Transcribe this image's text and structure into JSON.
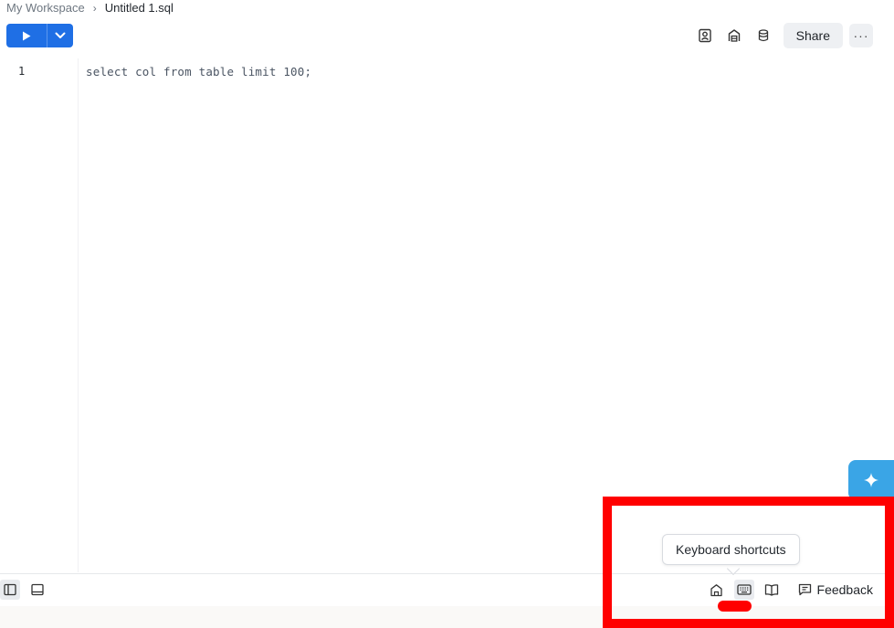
{
  "breadcrumb": {
    "root": "My Workspace",
    "separator": "›",
    "current": "Untitled 1.sql"
  },
  "toolbar": {
    "run_icon": "play-icon",
    "run_options_icon": "chevron-down-icon",
    "right_icons": [
      "contact-card-icon",
      "warehouse-icon",
      "database-icon"
    ],
    "share_label": "Share",
    "more_label": "···"
  },
  "editor": {
    "lines": [
      {
        "number": "1",
        "code": "select col from table limit 100;"
      }
    ]
  },
  "ai_button": {
    "icon": "sparkle-icon"
  },
  "bottom_bar": {
    "left_icons": [
      "sidebar-panel-icon",
      "bottom-panel-icon"
    ],
    "right_icons": [
      "home-icon",
      "keyboard-icon",
      "book-icon"
    ],
    "feedback_label": "Feedback",
    "tooltip": "Keyboard shortcuts"
  },
  "annotation": {
    "color": "#ff0000"
  },
  "colors": {
    "accent": "#1f6fe5",
    "ai_button": "#3aa5e6"
  }
}
